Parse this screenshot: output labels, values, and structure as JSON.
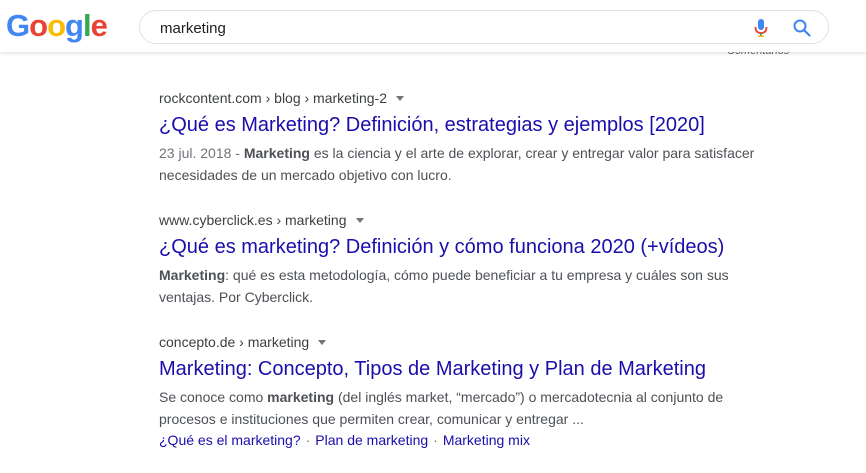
{
  "header": {
    "logo": [
      "G",
      "o",
      "o",
      "g",
      "l",
      "e"
    ],
    "logo_colors": [
      "#4285F4",
      "#EA4335",
      "#FBBC05",
      "#4285F4",
      "#34A853",
      "#EA4335"
    ],
    "search_value": "marketing",
    "mic_icon": "microphone-icon",
    "search_icon": "search-icon",
    "comentarios": "Comentarios"
  },
  "results": [
    {
      "cite": "rockcontent.com › blog › marketing-2",
      "title": "¿Qué es Marketing? Definición, estrategias y ejemplos [2020]",
      "date": "23 jul. 2018",
      "date_sep": " - ",
      "bold": "Marketing",
      "text1": " es la ciencia y el arte de explorar, crear y entregar valor para satisfacer necesidades de un mercado objetivo con lucro."
    },
    {
      "cite": "www.cyberclick.es › marketing",
      "title": "¿Qué es marketing? Definición y cómo funciona 2020 (+vídeos)",
      "bold": "Marketing",
      "text1": ": qué es esta metodología, cómo puede beneficiar a tu empresa y cuáles son sus ventajas. Por Cyberclick."
    },
    {
      "cite": "concepto.de › marketing",
      "title": "Marketing: Concepto, Tipos de Marketing y Plan de Marketing",
      "text0": "Se conoce como ",
      "bold": "marketing",
      "text1": " (del inglés market, “mercado”) o mercadotecnia al conjunto de procesos e instituciones que permiten crear, comunicar y entregar ...",
      "sitelinks": [
        "¿Qué es el marketing?",
        "Plan de marketing",
        "Marketing mix"
      ],
      "sitelink_sep": "·"
    }
  ]
}
